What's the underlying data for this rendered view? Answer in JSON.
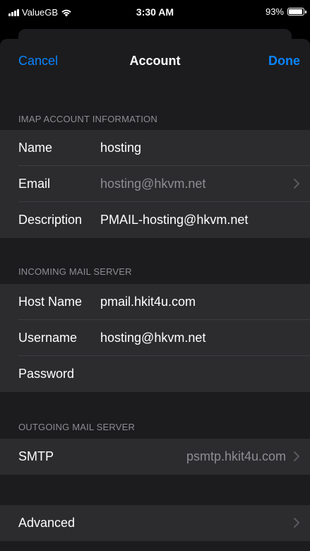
{
  "status_bar": {
    "carrier": "ValueGB",
    "time": "3:30 AM",
    "battery_text": "93%",
    "battery_level": 0.93
  },
  "nav": {
    "cancel_label": "Cancel",
    "title": "Account",
    "done_label": "Done"
  },
  "sections": {
    "imap": {
      "header": "IMAP ACCOUNT INFORMATION",
      "name_label": "Name",
      "name_value": "hosting",
      "email_label": "Email",
      "email_value": "hosting@hkvm.net",
      "description_label": "Description",
      "description_value": "PMAIL-hosting@hkvm.net"
    },
    "incoming": {
      "header": "INCOMING MAIL SERVER",
      "host_label": "Host Name",
      "host_value": "pmail.hkit4u.com",
      "username_label": "Username",
      "username_value": "hosting@hkvm.net",
      "password_label": "Password",
      "password_value": ""
    },
    "outgoing": {
      "header": "OUTGOING MAIL SERVER",
      "smtp_label": "SMTP",
      "smtp_value": "psmtp.hkit4u.com"
    },
    "advanced": {
      "label": "Advanced"
    }
  },
  "colors": {
    "accent": "#0a84ff",
    "background": "#000000",
    "sheet": "#1c1c1e",
    "cell": "#2c2c2e",
    "secondary_text": "#8d8d93"
  }
}
